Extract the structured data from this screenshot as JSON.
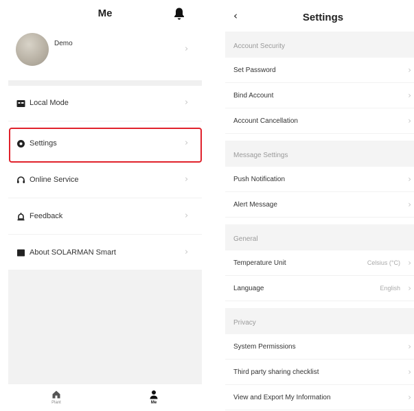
{
  "me": {
    "title": "Me",
    "bell_icon": "bell-icon",
    "profile": {
      "name": "Demo"
    },
    "menu": [
      {
        "id": "local-mode",
        "label": "Local Mode",
        "icon": "folder-icon"
      },
      {
        "id": "settings",
        "label": "Settings",
        "icon": "gear-icon"
      },
      {
        "id": "online-service",
        "label": "Online Service",
        "icon": "headset-icon"
      },
      {
        "id": "feedback",
        "label": "Feedback",
        "icon": "feedback-icon"
      },
      {
        "id": "about",
        "label": "About SOLARMAN Smart",
        "icon": "book-icon"
      }
    ],
    "highlight_color": "#e0202a",
    "tabs": [
      {
        "label": "Plant",
        "icon": "house-icon",
        "active": false
      },
      {
        "label": "Me",
        "icon": "person-icon",
        "active": true
      }
    ]
  },
  "settings": {
    "title": "Settings",
    "back_icon": "chevron-left-icon",
    "sections": [
      {
        "title": "Account Security",
        "items": [
          {
            "label": "Set Password"
          },
          {
            "label": "Bind Account"
          },
          {
            "label": "Account Cancellation"
          }
        ]
      },
      {
        "title": "Message Settings",
        "items": [
          {
            "label": "Push Notification"
          },
          {
            "label": "Alert Message"
          }
        ]
      },
      {
        "title": "General",
        "items": [
          {
            "label": "Temperature Unit",
            "value": "Celsius (°C)"
          },
          {
            "label": "Language",
            "value": "English"
          }
        ]
      },
      {
        "title": "Privacy",
        "items": [
          {
            "label": "System Permissions"
          },
          {
            "label": "Third party sharing checklist"
          },
          {
            "label": "View and Export My Information"
          }
        ]
      }
    ]
  }
}
